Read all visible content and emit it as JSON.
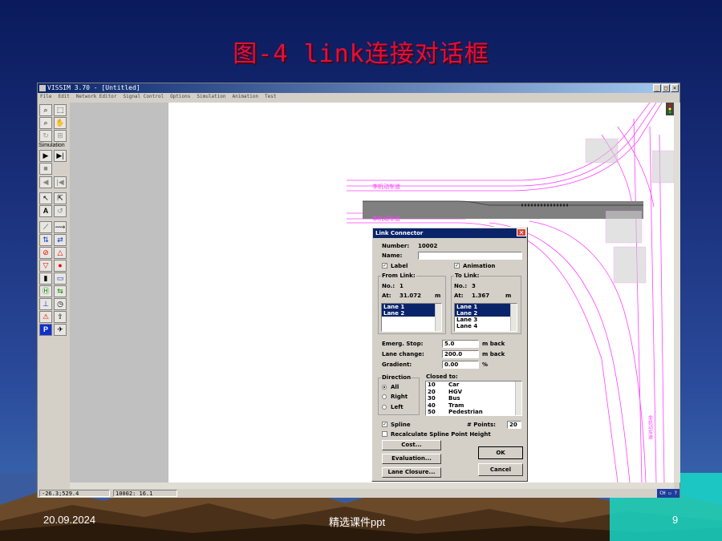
{
  "slide": {
    "title": "图-4 link连接对话框",
    "date": "20.09.2024",
    "footer": "精选课件ppt",
    "page": "9"
  },
  "window": {
    "title": "VISSIM 3.70 - [Untitled]",
    "menu": [
      "File",
      "Edit",
      "Network Editor",
      "Signal Control",
      "Options",
      "Simulation",
      "Animation",
      "Test"
    ],
    "toolbar_label": "Simulation",
    "status_coords": "-26.3;529.4",
    "status_link": "10002: 16.1",
    "tray": "CH"
  },
  "canvas": {
    "road_label_1": "李机动车道",
    "road_label_2": "李机动车道",
    "road_label_3": "非机动车道"
  },
  "dialog": {
    "title": "Link Connector",
    "number_label": "Number:",
    "number_value": "10002",
    "name_label": "Name:",
    "name_value": "",
    "label_cb": "Label",
    "animation_cb": "Animation",
    "from_link": {
      "title": "From Link:",
      "no_label": "No.:",
      "no_value": "1",
      "at_label": "At:",
      "at_value": "31.072",
      "unit": "m",
      "lanes": [
        {
          "name": "Lane 1",
          "selected": true
        },
        {
          "name": "Lane 2",
          "selected": true
        }
      ]
    },
    "to_link": {
      "title": "To Link:",
      "no_label": "No.:",
      "no_value": "3",
      "at_label": "At:",
      "at_value": "1.367",
      "unit": "m",
      "lanes": [
        {
          "name": "Lane 1",
          "selected": true
        },
        {
          "name": "Lane 2",
          "selected": true
        },
        {
          "name": "Lane 3",
          "selected": false
        },
        {
          "name": "Lane 4",
          "selected": false
        }
      ]
    },
    "emerg_stop_label": "Emerg. Stop:",
    "emerg_stop_value": "5.0",
    "emerg_stop_unit": "m back",
    "lane_change_label": "Lane change:",
    "lane_change_value": "200.0",
    "lane_change_unit": "m back",
    "gradient_label": "Gradient:",
    "gradient_value": "0.00",
    "gradient_unit": "%",
    "direction": {
      "title": "Direction",
      "options": [
        {
          "label": "All",
          "checked": true
        },
        {
          "label": "Right",
          "checked": false
        },
        {
          "label": "Left",
          "checked": false
        }
      ]
    },
    "closed_to": {
      "title": "Closed to:",
      "rows": [
        {
          "id": "10",
          "name": "Car"
        },
        {
          "id": "20",
          "name": "HGV"
        },
        {
          "id": "30",
          "name": "Bus"
        },
        {
          "id": "40",
          "name": "Tram"
        },
        {
          "id": "50",
          "name": "Pedestrian"
        }
      ]
    },
    "spline_cb": "Spline",
    "points_label": "# Points:",
    "points_value": "20",
    "recalc_cb": "Recalculate Spline Point Height",
    "cost_btn": "Cost...",
    "evaluation_btn": "Evaluation...",
    "lane_closure_btn": "Lane Closure...",
    "ok_btn": "OK",
    "cancel_btn": "Cancel"
  }
}
